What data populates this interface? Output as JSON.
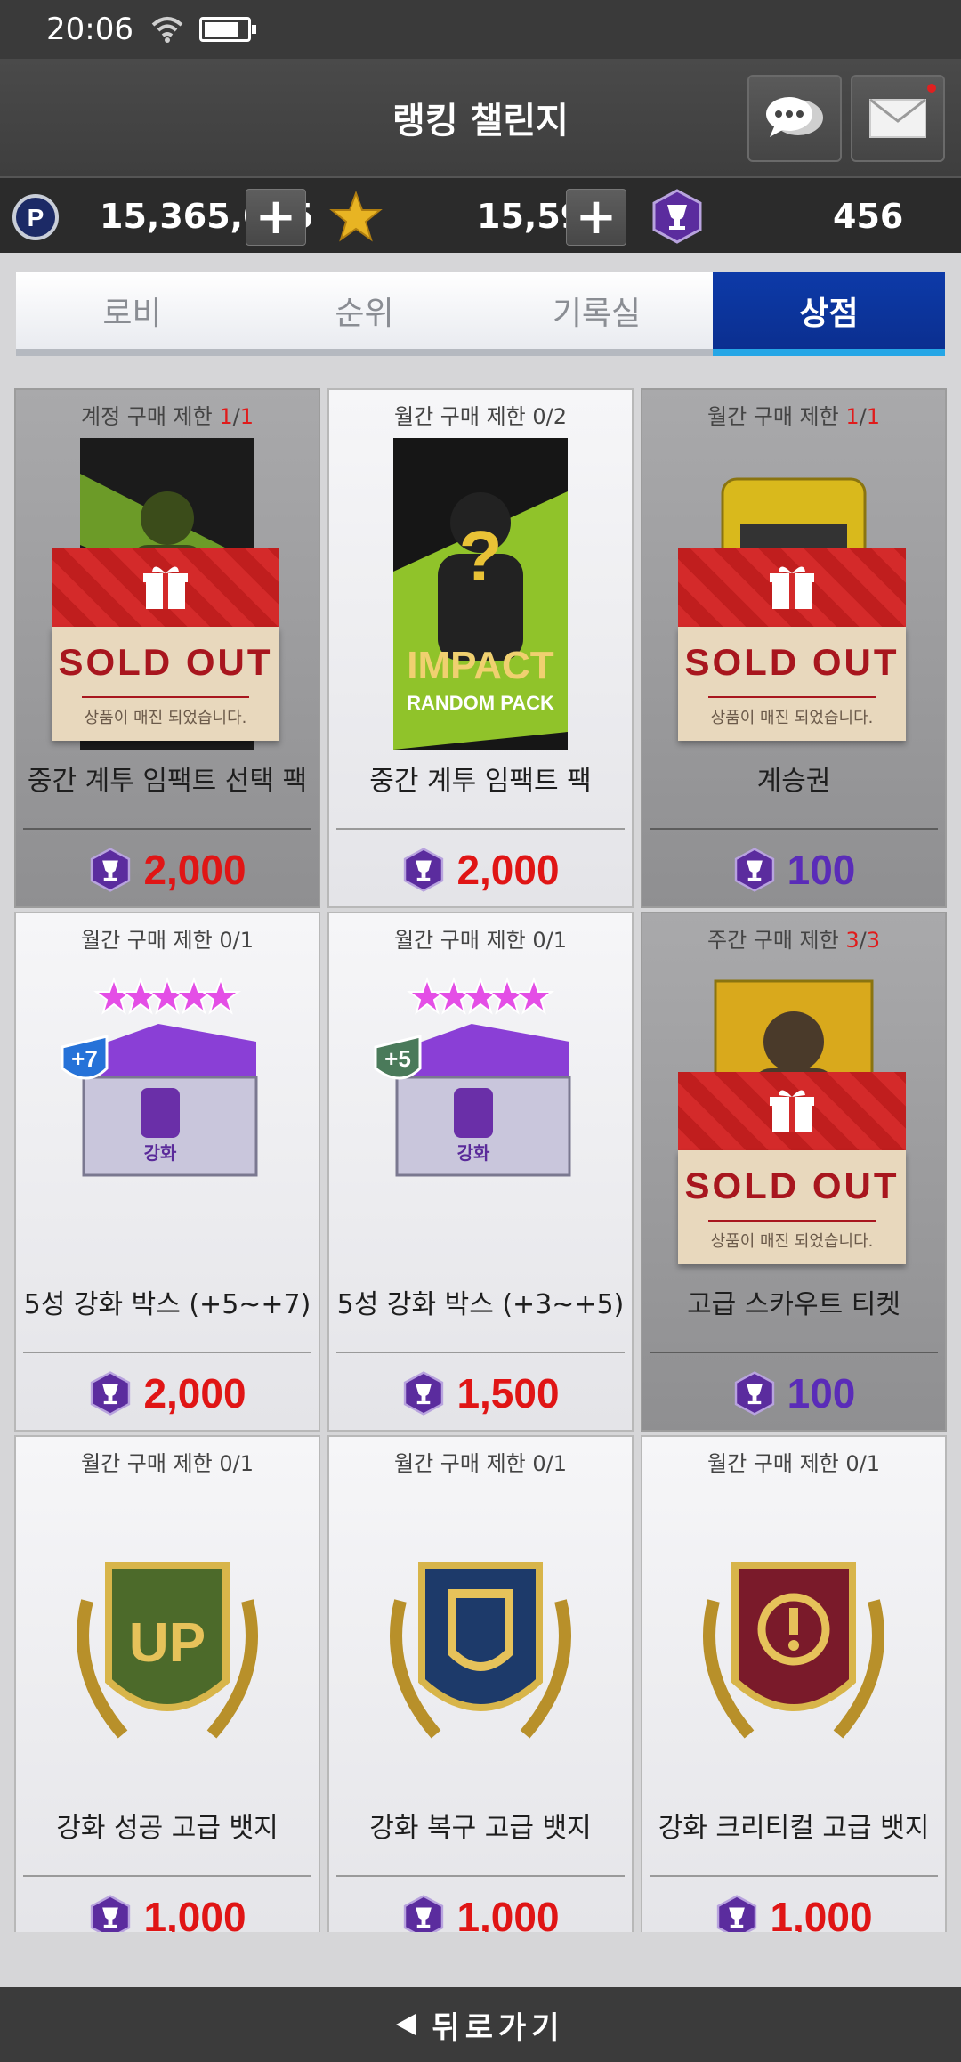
{
  "status": {
    "time": "20:06"
  },
  "header": {
    "title": "랭킹 챌린지"
  },
  "currency": {
    "points": "15,365,085",
    "stars": "15,590",
    "trophies": "456"
  },
  "tabs": [
    {
      "label": "로비",
      "active": false
    },
    {
      "label": "순위",
      "active": false
    },
    {
      "label": "기록실",
      "active": false
    },
    {
      "label": "상점",
      "active": true
    }
  ],
  "items": [
    {
      "limit": "계정 구매 제한 ",
      "count": "1",
      "sep": "/",
      "max": "1",
      "name": "중간 계투 임팩트 선택 팩",
      "price": "2,000",
      "sold_out": true
    },
    {
      "limit": "월간 구매 제한 0/2",
      "name": "중간 계투 임팩트 팩",
      "price": "2,000",
      "sold_out": false,
      "pack_title": "IMPACT",
      "pack_sub": "RANDOM PACK"
    },
    {
      "limit": "월간 구매 제한 ",
      "count": "1",
      "sep": "/",
      "max": "1",
      "name": "계승권",
      "price": "100",
      "sold_out": true
    },
    {
      "limit": "월간 구매 제한 0/1",
      "name": "5성 강화 박스 (+5~+7)",
      "price": "2,000",
      "sold_out": false,
      "badge": "+7",
      "box_label": "강화"
    },
    {
      "limit": "월간 구매 제한 0/1",
      "name": "5성 강화 박스 (+3~+5)",
      "price": "1,500",
      "sold_out": false,
      "badge": "+5",
      "box_label": "강화"
    },
    {
      "limit": "주간 구매 제한 ",
      "count": "3",
      "sep": "/",
      "max": "3",
      "name": "고급 스카우트 티켓",
      "price": "100",
      "sold_out": true
    },
    {
      "limit": "월간 구매 제한 0/1",
      "name": "강화 성공 고급 뱃지",
      "price": "1,000",
      "sold_out": false,
      "badge_text": "UP"
    },
    {
      "limit": "월간 구매 제한 0/1",
      "name": "강화 복구 고급 뱃지",
      "price": "1,000",
      "sold_out": false
    },
    {
      "limit": "월간 구매 제한 0/1",
      "name": "강화 크리티컬 고급 뱃지",
      "price": "1,000",
      "sold_out": false
    }
  ],
  "sold_out": {
    "title": "SOLD OUT",
    "subtitle": "상품이 매진 되었습니다."
  },
  "footer": {
    "back_label": "뒤로가기"
  },
  "colors": {
    "accent_tab": "#0d3aa8",
    "price_red": "#e01515",
    "price_purple": "#5a2cb8",
    "sold_ribbon": "#d42a2a"
  }
}
